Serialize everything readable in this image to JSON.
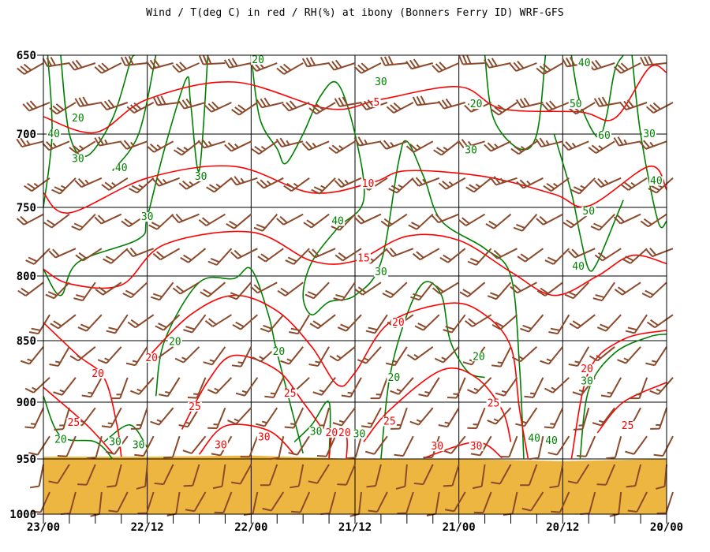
{
  "chart_data": {
    "type": "line",
    "title": "Wind / T(deg C) in red / RH(%) at ibony (Bonners Ferry ID)  WRF-GFS",
    "xlabel": "",
    "ylabel": "",
    "x_unit": "hours from left edge",
    "xlim": [
      0,
      72
    ],
    "ylim": [
      650,
      1000
    ],
    "y_ticks": [
      "650",
      "700",
      "750",
      "800",
      "850",
      "900",
      "950",
      "1000"
    ],
    "x_ticks": [
      {
        "h": 0,
        "label": "23/00"
      },
      {
        "h": 12,
        "label": "22/12"
      },
      {
        "h": 24,
        "label": "22/00"
      },
      {
        "h": 36,
        "label": "21/12"
      },
      {
        "h": 48,
        "label": "21/00"
      },
      {
        "h": 60,
        "label": "20/12"
      },
      {
        "h": 72,
        "label": "20/00"
      }
    ],
    "grid": true,
    "colors": {
      "temp": "#ff0000",
      "rh": "#008000",
      "wind": "#8b4a2b",
      "ground": "#ecb641"
    },
    "ground_pressure": [
      [
        0,
        948
      ],
      [
        12,
        948
      ],
      [
        24,
        947
      ],
      [
        36,
        950
      ],
      [
        48,
        950
      ],
      [
        60,
        952
      ],
      [
        66,
        951
      ],
      [
        72,
        950
      ]
    ],
    "isotherms": [
      {
        "value": 5,
        "points": [
          [
            0,
            689
          ],
          [
            6,
            699
          ],
          [
            12,
            678
          ],
          [
            22,
            667
          ],
          [
            33,
            684
          ],
          [
            39,
            678
          ],
          [
            48,
            670
          ],
          [
            53,
            684
          ],
          [
            62,
            686
          ],
          [
            66,
            690
          ],
          [
            70,
            658
          ],
          [
            72,
            661
          ]
        ]
      },
      {
        "value": 10,
        "points": [
          [
            0,
            740
          ],
          [
            3,
            754
          ],
          [
            12,
            730
          ],
          [
            22,
            722
          ],
          [
            31,
            740
          ],
          [
            38,
            733
          ],
          [
            42,
            725
          ],
          [
            51,
            729
          ],
          [
            59,
            741
          ],
          [
            63,
            749
          ],
          [
            70,
            722
          ],
          [
            72,
            738
          ]
        ]
      },
      {
        "value": 15,
        "points": [
          [
            0,
            795
          ],
          [
            3,
            806
          ],
          [
            9,
            807
          ],
          [
            14,
            777
          ],
          [
            24,
            768
          ],
          [
            31,
            789
          ],
          [
            36,
            789
          ],
          [
            42,
            771
          ],
          [
            48,
            774
          ],
          [
            54,
            797
          ],
          [
            59,
            815
          ],
          [
            64,
            800
          ],
          [
            68,
            785
          ],
          [
            72,
            791
          ]
        ]
      },
      {
        "value": 20,
        "points": [
          [
            0,
            836
          ],
          [
            4,
            862
          ],
          [
            7,
            880
          ],
          [
            8.5,
            920
          ],
          [
            9,
            948
          ]
        ]
      },
      {
        "value": 20,
        "points": [
          [
            12,
            864
          ],
          [
            17,
            830
          ],
          [
            22,
            815
          ],
          [
            27,
            827
          ],
          [
            31,
            855
          ],
          [
            34,
            886
          ],
          [
            36,
            876
          ],
          [
            40,
            836
          ],
          [
            47,
            821
          ],
          [
            51,
            830
          ],
          [
            54,
            855
          ],
          [
            55,
            906
          ],
          [
            56,
            950
          ]
        ]
      },
      {
        "value": 20,
        "points": [
          [
            61,
            950
          ],
          [
            63,
            875
          ],
          [
            67,
            849
          ],
          [
            72,
            842
          ]
        ]
      },
      {
        "value": 20,
        "points": [
          [
            33,
            950
          ],
          [
            33.5,
            925
          ],
          [
            35,
            930
          ],
          [
            35,
            950
          ]
        ]
      },
      {
        "value": 25,
        "points": [
          [
            0,
            888
          ],
          [
            5,
            920
          ],
          [
            8,
            945
          ]
        ]
      },
      {
        "value": 25,
        "points": [
          [
            16,
            924
          ],
          [
            19,
            883
          ],
          [
            22,
            862
          ],
          [
            27,
            874
          ],
          [
            30,
            900
          ],
          [
            32,
            921
          ]
        ]
      },
      {
        "value": 25,
        "points": [
          [
            37,
            935
          ],
          [
            40,
            907
          ],
          [
            46,
            874
          ],
          [
            50,
            880
          ],
          [
            53,
            907
          ],
          [
            54,
            935
          ]
        ]
      },
      {
        "value": 25,
        "points": [
          [
            64,
            927
          ],
          [
            67,
            900
          ],
          [
            72,
            884
          ]
        ]
      },
      {
        "value": 30,
        "points": [
          [
            18,
            946
          ],
          [
            21,
            921
          ],
          [
            26,
            925
          ],
          [
            29,
            946
          ]
        ]
      },
      {
        "value": 30,
        "points": [
          [
            44,
            949
          ],
          [
            50,
            935
          ],
          [
            53,
            949
          ]
        ]
      }
    ],
    "rh_contours": [
      {
        "value": 40,
        "points": [
          [
            0.5,
            650
          ],
          [
            1,
            700
          ],
          [
            0,
            750
          ]
        ]
      },
      {
        "value": 20,
        "points": [
          [
            2,
            650
          ],
          [
            3,
            700
          ],
          [
            5,
            715
          ],
          [
            8,
            690
          ],
          [
            10,
            655
          ],
          [
            10.5,
            650
          ]
        ]
      },
      {
        "value": 40,
        "points": [
          [
            8,
            725
          ],
          [
            11,
            700
          ],
          [
            13,
            650
          ]
        ]
      },
      {
        "value": 30,
        "points": [
          [
            0,
            795
          ],
          [
            2,
            815
          ],
          [
            4,
            790
          ],
          [
            11,
            773
          ],
          [
            12,
            757
          ],
          [
            14,
            710
          ],
          [
            16.5,
            665
          ],
          [
            17,
            680
          ],
          [
            18,
            725
          ],
          [
            19,
            650
          ]
        ]
      },
      {
        "value": 20,
        "points": [
          [
            13,
            895
          ],
          [
            14,
            850
          ],
          [
            18,
            805
          ],
          [
            22,
            802
          ],
          [
            24,
            795
          ],
          [
            26,
            830
          ],
          [
            27,
            860
          ],
          [
            30,
            945
          ]
        ]
      },
      {
        "value": 40,
        "points": [
          [
            24,
            650
          ],
          [
            25,
            690
          ],
          [
            27,
            710
          ],
          [
            28,
            720
          ],
          [
            30,
            700
          ],
          [
            32,
            676
          ],
          [
            34,
            668
          ],
          [
            36,
            700
          ],
          [
            37,
            745
          ],
          [
            34,
            765
          ],
          [
            31,
            790
          ],
          [
            30,
            815
          ],
          [
            31,
            830
          ],
          [
            33,
            820
          ],
          [
            36,
            815
          ],
          [
            39,
            790
          ],
          [
            41,
            720
          ],
          [
            42,
            705
          ],
          [
            44,
            730
          ],
          [
            46,
            760
          ],
          [
            51,
            780
          ],
          [
            54,
            800
          ],
          [
            55,
            870
          ],
          [
            55.5,
            950
          ]
        ]
      },
      {
        "value": 20,
        "points": [
          [
            39,
            950
          ],
          [
            40,
            880
          ],
          [
            42,
            830
          ],
          [
            44,
            805
          ],
          [
            46,
            815
          ],
          [
            47,
            850
          ],
          [
            49,
            875
          ],
          [
            51,
            880
          ]
        ]
      },
      {
        "value": 30,
        "points": [
          [
            51,
            650
          ],
          [
            52,
            690
          ],
          [
            55,
            710
          ],
          [
            57,
            700
          ],
          [
            58,
            650
          ]
        ]
      },
      {
        "value": 50,
        "points": [
          [
            61,
            650
          ],
          [
            62,
            680
          ],
          [
            64,
            702
          ],
          [
            65,
            690
          ],
          [
            66,
            660
          ],
          [
            67,
            650
          ]
        ]
      },
      {
        "value": 30,
        "points": [
          [
            68,
            650
          ],
          [
            69,
            700
          ],
          [
            71,
            760
          ],
          [
            72,
            760
          ]
        ]
      },
      {
        "value": 40,
        "points": [
          [
            59,
            700
          ],
          [
            61,
            740
          ],
          [
            62,
            770
          ],
          [
            63,
            795
          ],
          [
            64,
            790
          ],
          [
            66,
            760
          ],
          [
            67,
            745
          ]
        ]
      },
      {
        "value": 30,
        "points": [
          [
            62,
            950
          ],
          [
            63,
            890
          ],
          [
            66,
            860
          ],
          [
            70,
            847
          ],
          [
            72,
            845
          ]
        ]
      },
      {
        "value": 20,
        "points": [
          [
            0,
            895
          ],
          [
            2,
            930
          ],
          [
            6,
            935
          ],
          [
            8,
            950
          ]
        ]
      },
      {
        "value": 30,
        "points": [
          [
            7,
            935
          ],
          [
            10,
            920
          ],
          [
            12,
            940
          ]
        ]
      },
      {
        "value": 30,
        "points": [
          [
            29,
            935
          ],
          [
            31,
            920
          ],
          [
            33,
            900
          ],
          [
            33,
            950
          ]
        ]
      }
    ],
    "temp_labels": [
      {
        "t": "5",
        "h": 38.5,
        "p": 680
      },
      {
        "t": "10",
        "h": 37.5,
        "p": 734
      },
      {
        "t": "15",
        "h": 37,
        "p": 787
      },
      {
        "t": "20",
        "h": 41,
        "p": 836
      },
      {
        "t": "20",
        "h": 6.3,
        "p": 877
      },
      {
        "t": "20",
        "h": 12.5,
        "p": 864
      },
      {
        "t": "25",
        "h": 3.5,
        "p": 918
      },
      {
        "t": "25",
        "h": 17.5,
        "p": 904
      },
      {
        "t": "25",
        "h": 28.5,
        "p": 893
      },
      {
        "t": "25",
        "h": 40,
        "p": 917
      },
      {
        "t": "25",
        "h": 52,
        "p": 901
      },
      {
        "t": "25",
        "h": 67.5,
        "p": 921
      },
      {
        "t": "20",
        "h": 62.8,
        "p": 873
      },
      {
        "t": "30",
        "h": 20.5,
        "p": 938
      },
      {
        "t": "30",
        "h": 25.5,
        "p": 931
      },
      {
        "t": "30",
        "h": 45.5,
        "p": 939
      },
      {
        "t": "30",
        "h": 50,
        "p": 939
      },
      {
        "t": "20",
        "h": 33.3,
        "p": 927
      },
      {
        "t": "20",
        "h": 34.8,
        "p": 927
      }
    ],
    "rh_labels": [
      {
        "t": "20",
        "h": 4,
        "p": 690
      },
      {
        "t": "40",
        "h": 1.2,
        "p": 700
      },
      {
        "t": "30",
        "h": 4,
        "p": 717
      },
      {
        "t": "40",
        "h": 9,
        "p": 723
      },
      {
        "t": "30",
        "h": 18.2,
        "p": 729
      },
      {
        "t": "30",
        "h": 12,
        "p": 757
      },
      {
        "t": "20",
        "h": 24.8,
        "p": 653
      },
      {
        "t": "30",
        "h": 39,
        "p": 667
      },
      {
        "t": "20",
        "h": 50,
        "p": 681
      },
      {
        "t": "40",
        "h": 62.5,
        "p": 655
      },
      {
        "t": "50",
        "h": 61.5,
        "p": 681
      },
      {
        "t": "60",
        "h": 64.8,
        "p": 701
      },
      {
        "t": "30",
        "h": 70,
        "p": 700
      },
      {
        "t": "40",
        "h": 70.8,
        "p": 732
      },
      {
        "t": "50",
        "h": 63,
        "p": 753
      },
      {
        "t": "40",
        "h": 61.8,
        "p": 793
      },
      {
        "t": "40",
        "h": 34,
        "p": 760
      },
      {
        "t": "30",
        "h": 39,
        "p": 797
      },
      {
        "t": "30",
        "h": 49.4,
        "p": 711
      },
      {
        "t": "20",
        "h": 15.2,
        "p": 851
      },
      {
        "t": "20",
        "h": 27.2,
        "p": 859
      },
      {
        "t": "20",
        "h": 40.5,
        "p": 880
      },
      {
        "t": "20",
        "h": 50.3,
        "p": 863
      },
      {
        "t": "30",
        "h": 62.8,
        "p": 883
      },
      {
        "t": "20",
        "h": 2,
        "p": 933
      },
      {
        "t": "30",
        "h": 8.3,
        "p": 935
      },
      {
        "t": "30",
        "h": 11,
        "p": 938
      },
      {
        "t": "30",
        "h": 31.5,
        "p": 926
      },
      {
        "t": "30",
        "h": 36.5,
        "p": 928
      },
      {
        "t": "40",
        "h": 56.7,
        "p": 932
      },
      {
        "t": "40",
        "h": 58.7,
        "p": 934
      }
    ],
    "wind": {
      "times_every_hours": 3,
      "levels": [
        {
          "p": 655,
          "dir": 255,
          "kt": 30
        },
        {
          "p": 680,
          "dir": 250,
          "kt": 30
        },
        {
          "p": 705,
          "dir": 245,
          "kt": 25
        },
        {
          "p": 730,
          "dir": 240,
          "kt": 25
        },
        {
          "p": 755,
          "dir": 235,
          "kt": 20
        },
        {
          "p": 780,
          "dir": 235,
          "kt": 20
        },
        {
          "p": 805,
          "dir": 230,
          "kt": 20
        },
        {
          "p": 830,
          "dir": 225,
          "kt": 20
        },
        {
          "p": 855,
          "dir": 220,
          "kt": 15
        },
        {
          "p": 880,
          "dir": 215,
          "kt": 15
        },
        {
          "p": 905,
          "dir": 210,
          "kt": 15
        },
        {
          "p": 930,
          "dir": 205,
          "kt": 10
        },
        {
          "p": 955,
          "dir": 200,
          "kt": 10
        },
        {
          "p": 980,
          "dir": 200,
          "kt": 10
        }
      ]
    }
  }
}
